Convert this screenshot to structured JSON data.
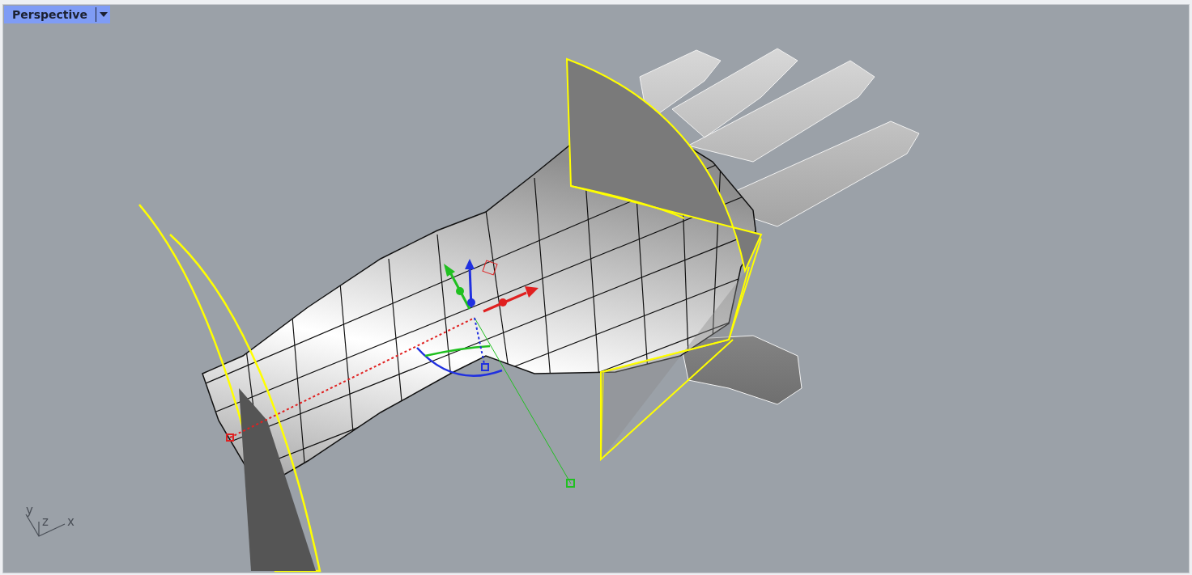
{
  "viewport": {
    "title": "Perspective",
    "active": true
  },
  "axis_labels": [
    "y",
    "z",
    "x"
  ]
}
